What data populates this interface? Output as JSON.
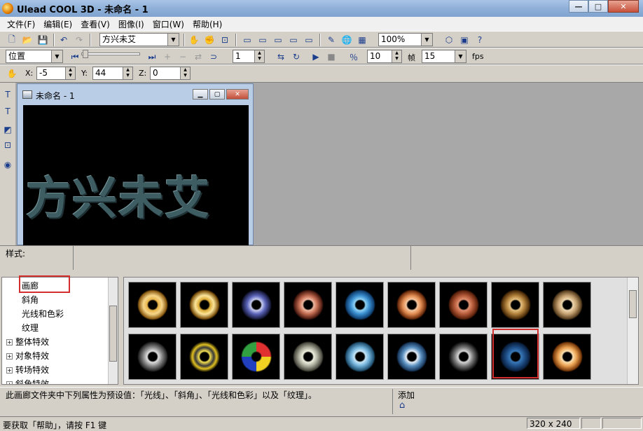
{
  "window": {
    "title": "Ulead COOL 3D - 未命名 - 1",
    "min": "—",
    "max": "□",
    "close": "✕"
  },
  "menu": [
    "文件(F)",
    "编辑(E)",
    "查看(V)",
    "图像(I)",
    "窗口(W)",
    "帮助(H)"
  ],
  "toolbar1": {
    "font_select": "方兴未艾",
    "zoom_select": "100%"
  },
  "toolbar2": {
    "attr_select": "位置",
    "frame_value": "1",
    "frames_value": "10",
    "frames_label": "帧",
    "fps_value": "15",
    "fps_label": "fps"
  },
  "toolbar3": {
    "x_label": "X:",
    "x_value": "-5",
    "y_label": "Y:",
    "y_value": "44",
    "z_label": "Z:",
    "z_value": "0"
  },
  "doc": {
    "title": "未命名 - 1",
    "text": "方兴未艾"
  },
  "style_panel": {
    "label": "样式:"
  },
  "tree": {
    "items": [
      {
        "label": "画廊",
        "indent": 2,
        "expand": ""
      },
      {
        "label": "斜角",
        "indent": 2,
        "expand": ""
      },
      {
        "label": "光线和色彩",
        "indent": 2,
        "expand": ""
      },
      {
        "label": "纹理",
        "indent": 2,
        "expand": ""
      },
      {
        "label": "整体特效",
        "indent": 0,
        "expand": "+"
      },
      {
        "label": "对象特效",
        "indent": 0,
        "expand": "+"
      },
      {
        "label": "转场特效",
        "indent": 0,
        "expand": "+"
      },
      {
        "label": "斜角特效",
        "indent": 0,
        "expand": "+"
      }
    ]
  },
  "description": {
    "text": "此画廊文件夹中下列属性为预设值：「光线」、「斜角」、「光线和色彩」以及「纹理」。",
    "add_label": "添加"
  },
  "status": {
    "help": "要获取「帮助」，请按 F1 键",
    "size": "320 x 240"
  },
  "colors": {
    "highlight": "#d32f2f",
    "workspace": "#a8a8a8"
  }
}
